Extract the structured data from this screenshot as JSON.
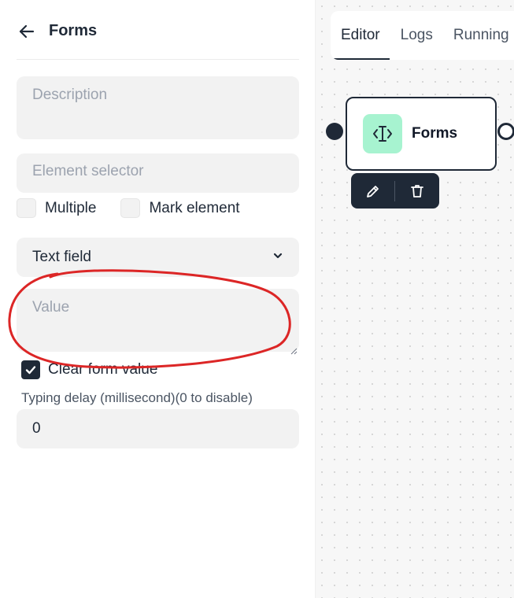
{
  "panel": {
    "title": "Forms",
    "back_icon": "arrow-left-icon",
    "description": {
      "placeholder": "Description",
      "value": ""
    },
    "element_selector": {
      "placeholder": "Element selector",
      "value": ""
    },
    "multiple_label": "Multiple",
    "multiple_checked": false,
    "mark_element_label": "Mark element",
    "mark_element_checked": false,
    "form_type": {
      "selected": "Text field",
      "icon": "chevron-down-icon"
    },
    "value_field": {
      "placeholder": "Value",
      "value": ""
    },
    "clear_form_value_label": "Clear form value",
    "clear_form_value_checked": true,
    "typing_delay_label": "Typing delay (millisecond)(0 to disable)",
    "typing_delay_value": "0"
  },
  "editor": {
    "tabs": [
      {
        "label": "Editor",
        "active": true
      },
      {
        "label": "Logs",
        "active": false
      },
      {
        "label": "Running",
        "active": false
      }
    ],
    "node": {
      "label": "Forms",
      "icon": "text-cursor-icon",
      "icon_bg": "#a7f3d0"
    },
    "toolbar": {
      "edit_icon": "pencil-icon",
      "delete_icon": "trash-icon"
    }
  },
  "annotation": {
    "color": "#dc2626",
    "shape": "freehand-circle"
  }
}
